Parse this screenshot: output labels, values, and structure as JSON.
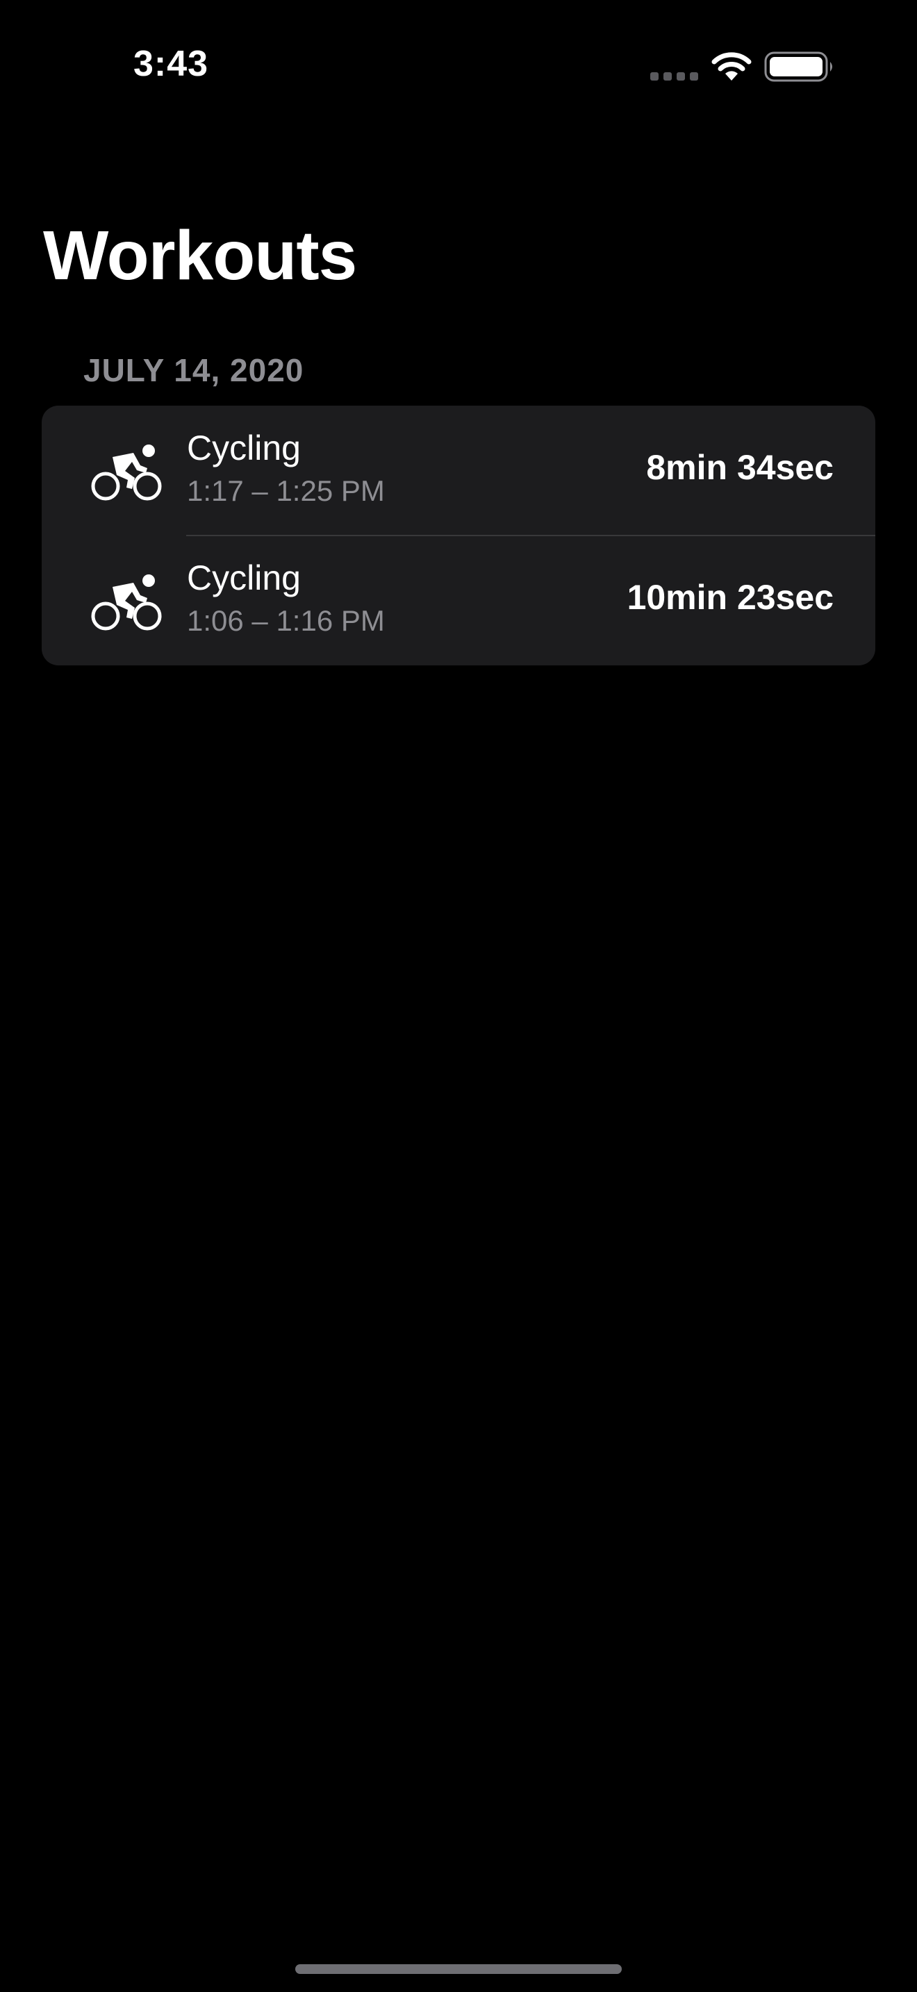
{
  "status_bar": {
    "time": "3:43"
  },
  "page": {
    "title": "Workouts"
  },
  "sections": [
    {
      "header": "JULY 14, 2020",
      "workouts": [
        {
          "icon": "cycling-icon",
          "name": "Cycling",
          "time_range": "1:17 – 1:25 PM",
          "duration": "8min 34sec"
        },
        {
          "icon": "cycling-icon",
          "name": "Cycling",
          "time_range": "1:06 – 1:16 PM",
          "duration": "10min 23sec"
        }
      ]
    }
  ],
  "colors": {
    "background": "#000000",
    "card": "#1c1c1e",
    "primary_text": "#ffffff",
    "secondary_text": "#8e8e93",
    "separator": "#38383a"
  }
}
